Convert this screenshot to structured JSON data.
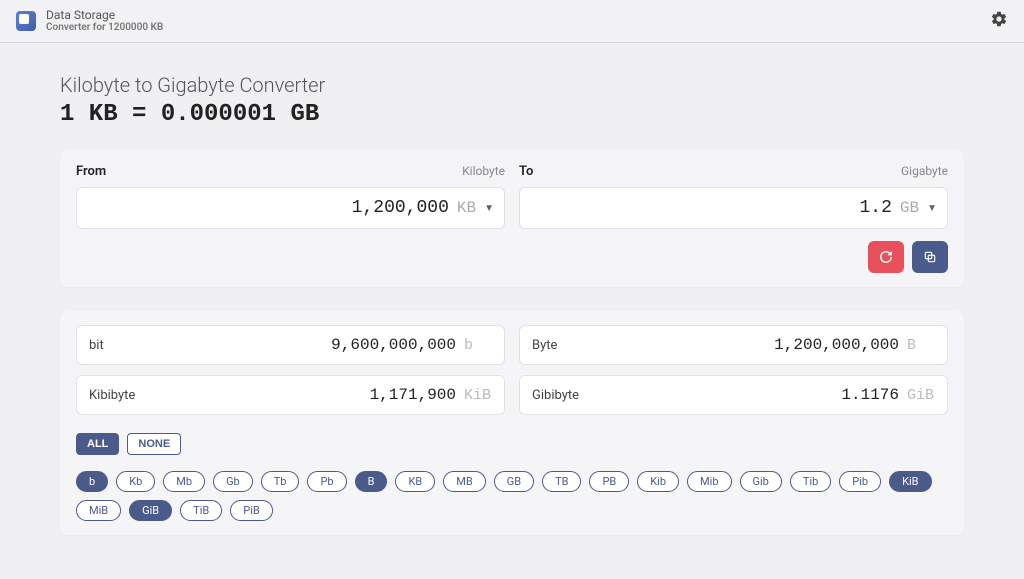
{
  "header": {
    "title": "Data Storage",
    "subtitle": "Converter for 1200000 KB"
  },
  "page": {
    "title": "Kilobyte to Gigabyte Converter",
    "equation": "1 KB = 0.000001 GB"
  },
  "from": {
    "label": "From",
    "unit_name": "Kilobyte",
    "value": "1,200,000",
    "unit": "KB"
  },
  "to": {
    "label": "To",
    "unit_name": "Gigabyte",
    "value": "1.2",
    "unit": "GB"
  },
  "results": [
    {
      "label": "bit",
      "value": "9,600,000,000",
      "unit": "b"
    },
    {
      "label": "Byte",
      "value": "1,200,000,000",
      "unit": "B"
    },
    {
      "label": "Kibibyte",
      "value": "1,171,900",
      "unit": "KiB"
    },
    {
      "label": "Gibibyte",
      "value": "1.1176",
      "unit": "GiB"
    }
  ],
  "filters": {
    "all": "ALL",
    "none": "NONE",
    "active": "all"
  },
  "chips": [
    {
      "label": "b",
      "active": true
    },
    {
      "label": "Kb",
      "active": false
    },
    {
      "label": "Mb",
      "active": false
    },
    {
      "label": "Gb",
      "active": false
    },
    {
      "label": "Tb",
      "active": false
    },
    {
      "label": "Pb",
      "active": false
    },
    {
      "label": "B",
      "active": true
    },
    {
      "label": "KB",
      "active": false
    },
    {
      "label": "MB",
      "active": false
    },
    {
      "label": "GB",
      "active": false
    },
    {
      "label": "TB",
      "active": false
    },
    {
      "label": "PB",
      "active": false
    },
    {
      "label": "Kib",
      "active": false
    },
    {
      "label": "Mib",
      "active": false
    },
    {
      "label": "Gib",
      "active": false
    },
    {
      "label": "Tib",
      "active": false
    },
    {
      "label": "Pib",
      "active": false
    },
    {
      "label": "KiB",
      "active": true
    },
    {
      "label": "MiB",
      "active": false
    },
    {
      "label": "GiB",
      "active": true
    },
    {
      "label": "TiB",
      "active": false
    },
    {
      "label": "PiB",
      "active": false
    }
  ]
}
